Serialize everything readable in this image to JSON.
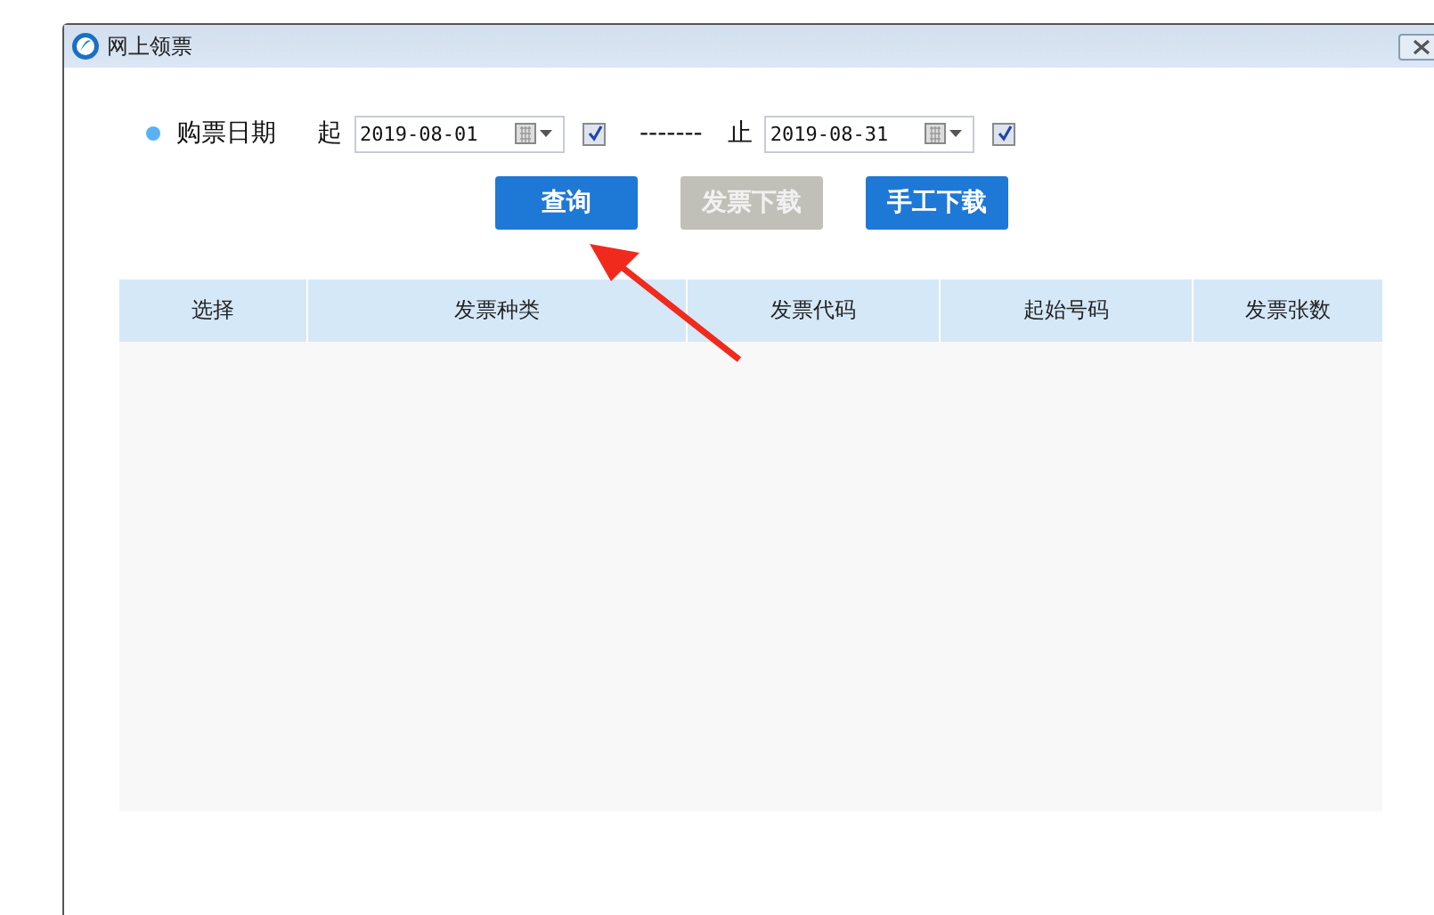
{
  "window": {
    "title": "网上领票"
  },
  "date_filter": {
    "label": "购票日期",
    "start": {
      "label": "起",
      "value": "2019-08-01",
      "checked": true
    },
    "separator": "-------",
    "end": {
      "label": "止",
      "value": "2019-08-31",
      "checked": true
    }
  },
  "buttons": [
    {
      "label": "查询",
      "disabled": false
    },
    {
      "label": "发票下载",
      "disabled": true
    },
    {
      "label": "手工下载",
      "disabled": false
    }
  ],
  "table": {
    "columns": [
      "选择",
      "发票种类",
      "发票代码",
      "起始号码",
      "发票张数"
    ]
  }
}
